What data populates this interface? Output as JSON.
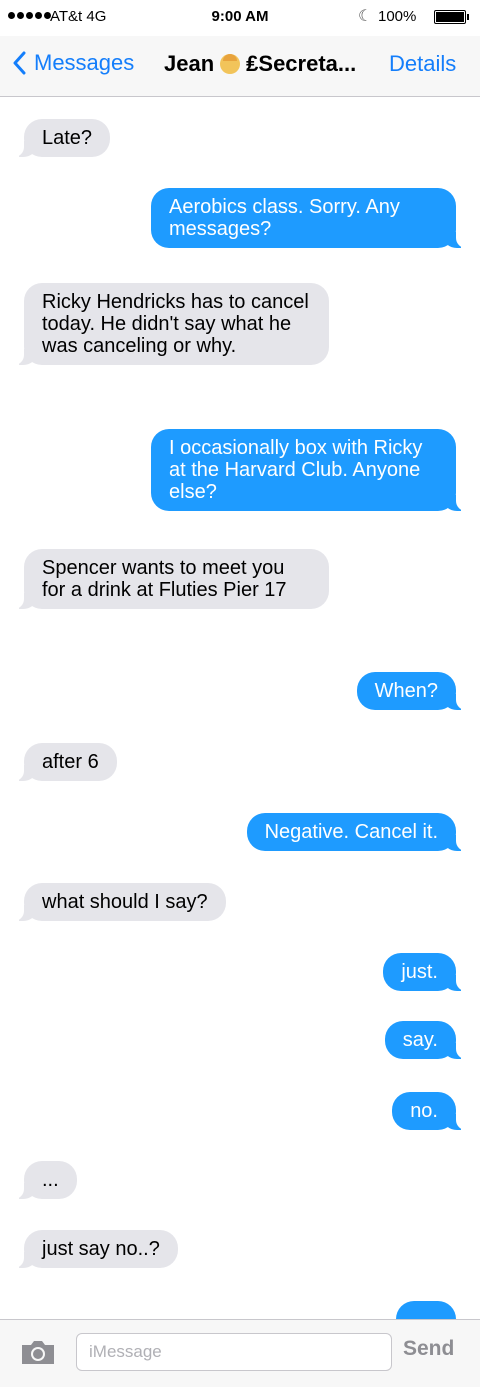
{
  "status_bar": {
    "carrier": "AT&t  4G",
    "time": "9:00 AM",
    "battery": "100%"
  },
  "nav": {
    "back_label": "Messages",
    "contact_first": "Jean",
    "contact_rest": "₤Secreta...",
    "details_label": "Details"
  },
  "messages": [
    {
      "from": "them",
      "text": "Late?"
    },
    {
      "from": "me",
      "text": "Aerobics class. Sorry. Any messages?"
    },
    {
      "from": "them",
      "text": "Ricky Hendricks has to cancel today. He didn't say what he was canceling or why."
    },
    {
      "from": "me",
      "text": "I occasionally box with Ricky at the Harvard Club. Anyone else?"
    },
    {
      "from": "them",
      "text": "Spencer wants to meet you for a drink at Fluties Pier 17"
    },
    {
      "from": "me",
      "text": "When?"
    },
    {
      "from": "them",
      "text": "after 6"
    },
    {
      "from": "me",
      "text": "Negative. Cancel it."
    },
    {
      "from": "them",
      "text": "what should I say?"
    },
    {
      "from": "me",
      "text": "just."
    },
    {
      "from": "me",
      "text": "say."
    },
    {
      "from": "me",
      "text": "no."
    },
    {
      "from": "them",
      "text": "..."
    },
    {
      "from": "them",
      "text": "just say no..?"
    },
    {
      "from": "me",
      "text": ""
    }
  ],
  "input_bar": {
    "placeholder": "iMessage",
    "send_label": "Send"
  },
  "colors": {
    "accent": "#147efb",
    "sent_bubble": "#1e9bff",
    "received_bubble": "#e5e5ea"
  }
}
